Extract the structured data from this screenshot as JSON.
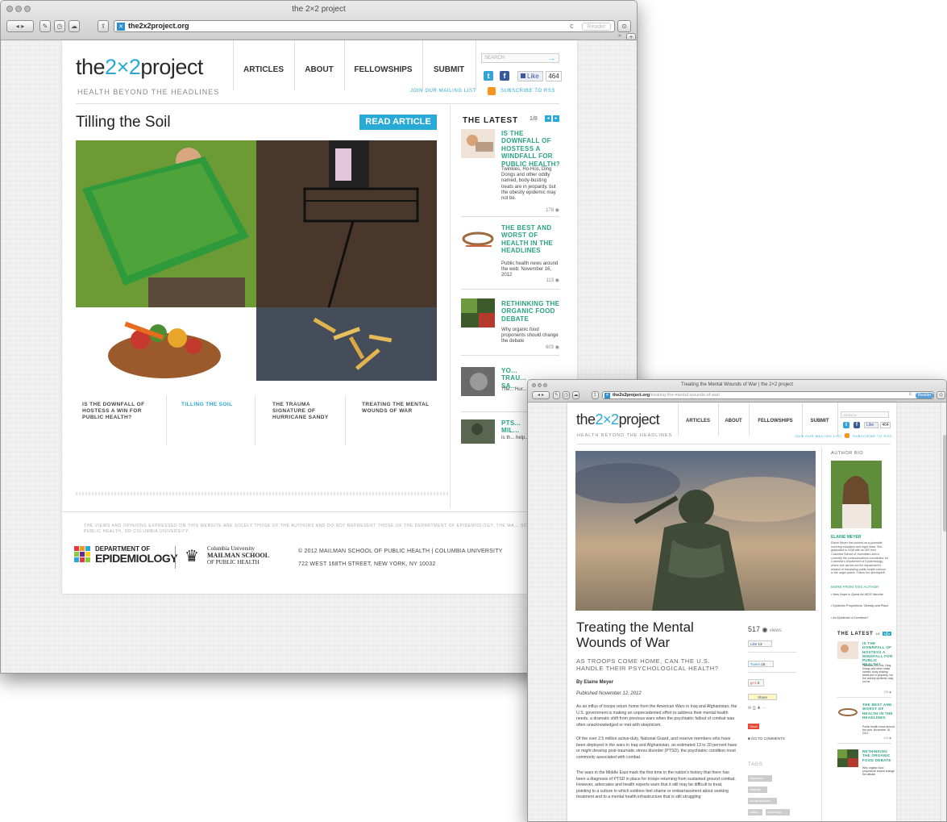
{
  "window1": {
    "title": "the 2×2 project",
    "url": "the2x2project.org",
    "reader_label": "Reader"
  },
  "window2": {
    "title": "Treating the Mental Wounds of War | the 2×2 project",
    "url_domain": "the2x2project.org",
    "url_path": "/treating-the-mental-wounds-of-war/",
    "reader_label": "Reader"
  },
  "site": {
    "logo_left": "the",
    "logo_mid": "2×2",
    "logo_right": "project",
    "tagline": "HEALTH BEYOND THE HEADLINES",
    "nav": [
      "ARTICLES",
      "ABOUT",
      "FELLOWSHIPS",
      "SUBMIT"
    ],
    "search_placeholder": "SEARCH",
    "like_label": "Like",
    "like_count": "464",
    "like_count_2": "464",
    "mailing_list": "JOIN OUR MAILING LIST",
    "rss": "SUBSCRIBE TO RSS"
  },
  "feature": {
    "title": "Tilling the Soil",
    "read_button": "READ ARTICLE",
    "tabs": [
      "IS THE DOWNFALL OF HOSTESS A WIN FOR PUBLIC HEALTH?",
      "TILLING THE SOIL",
      "THE TRAUMA SIGNATURE OF HURRICANE SANDY",
      "TREATING THE MENTAL WOUNDS OF WAR"
    ]
  },
  "latest": {
    "heading": "THE LATEST",
    "page": "1/8",
    "items": [
      {
        "title": "IS THE DOWNFALL OF HOSTESS A WINDFALL FOR PUBLIC HEALTH?",
        "desc": "Twinkies, Ho-Hos, Ding Dongs and other oddly named, body-busting treats are in jeopardy, but the obesity epidemic may not be.",
        "count": "178"
      },
      {
        "title": "THE BEST AND WORST OF HEALTH IN THE HEADLINES",
        "desc": "Public health news around the web: November 16, 2012",
        "count": "113"
      },
      {
        "title": "RETHINKING THE ORGANIC FOOD DEBATE",
        "desc": "Why organic food proponents should change the debate",
        "count": "603"
      },
      {
        "title": "YO... TRAU... SA...",
        "desc": "The... Hur...",
        "count": ""
      },
      {
        "title": "PTS... MIL...",
        "desc": "Is th... help...",
        "count": ""
      }
    ]
  },
  "footer": {
    "disclaimer": "THE VIEWS AND OPINIONS EXPRESSED ON THIS WEBSITE ARE SOLELY THOSE OF THE AUTHORS AND DO NOT REPRESENT THOSE OF THE DEPARTMENT OF EPIDEMIOLOGY, THE MA... SCHOOL OF PUBLIC HEALTH, OR COLUMBIA UNIVERSITY.",
    "epi_line1": "DEPARTMENT OF",
    "epi_line2": "EPIDEMIOLOGY",
    "cu_line1": "Columbia University",
    "cu_line2": "MAILMAN SCHOOL",
    "cu_line3": "OF PUBLIC HEALTH",
    "copyright": "© 2012 MAILMAN SCHOOL OF PUBLIC HEALTH | COLUMBIA UNIVERSITY",
    "address": "722 WEST 168TH STREET, NEW YORK, NY 10032"
  },
  "article": {
    "title": "Treating the Mental Wounds of War",
    "subtitle": "AS TROOPS COME HOME, CAN THE U.S. HANDLE THEIR PSYCHOLOGICAL HEALTH?",
    "byline": "By Elaine Meyer",
    "published": "Published November 12, 2012",
    "views_count": "517",
    "views_label": "views",
    "like_count": "13",
    "tweet_label": "Tweet",
    "tweet_count": "16",
    "gplus_count": "0",
    "share_label": "Share",
    "goto_comments": "GO TO COMMENTS",
    "tags_heading": "TAGS",
    "tags": [
      "depression",
      "disability",
      "mental disorders",
      "military",
      "psychology"
    ],
    "paragraphs": [
      "As an influx of troops return home from the American Wars in Iraq and Afghanistan, the U.S. government is making an unprecedented effort to address their mental health needs, a dramatic shift from previous wars when the psychiatric fallout of combat was often unacknowledged or met with skepticism.",
      "Of the over 2.5 million active-duty, National Guard, and reserve members who have been deployed in the wars in Iraq and Afghanistan, an estimated 13 to 20 percent have or might develop post-traumatic stress disorder (PTSD), the psychiatric condition most commonly associated with combat.",
      "The wars in the Middle East mark the first time in the nation's history that there has been a diagnosis of PTSD in place for troops returning from sustained ground combat. However, advocates and health experts warn that it still may be difficult to treat, pointing to a culture in which soldiers feel shame or embarrassment about seeking treatment and to a mental health infrastructure that is still struggling"
    ]
  },
  "author": {
    "heading": "AUTHOR BIO",
    "name": "ELAINE MEYER",
    "bio": "Elaine Meyer has worked as a journalist covering education and legal news. She graduated in 2008 with an MS from Columbia School of Journalism and is currently the communications coordinator for Columbia's Department of Epidemiology, where she carries out the department's mission of translating public health science to the larger public. Follow her @emeyer5.",
    "more_heading": "MORE FROM THIS AUTHOR",
    "more": [
      "New Hope in Quest for AIDS Vaccine",
      "Epidemic Proportions: Obesity and Place",
      "An Epidemic of Overtime?"
    ]
  },
  "colors": {
    "accent_blue": "#28a9d6",
    "accent_green": "#27a37d",
    "rss_orange": "#f7941d",
    "facebook": "#3b5998",
    "twitter": "#33a3d6"
  }
}
